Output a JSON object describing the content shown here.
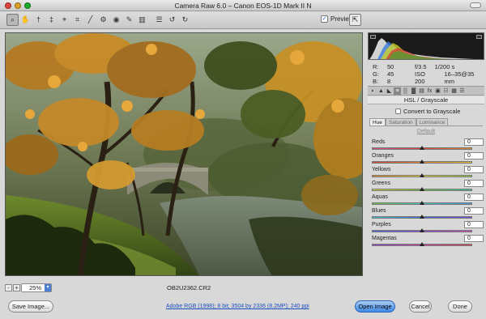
{
  "window": {
    "title": "Camera Raw 6.0  –  Canon EOS-1D Mark II N"
  },
  "toolbar": {
    "tools": [
      {
        "name": "zoom-tool-icon",
        "glyph": "⌕",
        "active": true
      },
      {
        "name": "hand-tool-icon",
        "glyph": "✋",
        "active": false
      },
      {
        "name": "white-balance-tool-icon",
        "glyph": "†",
        "active": false
      },
      {
        "name": "color-sampler-tool-icon",
        "glyph": "‡",
        "active": false
      },
      {
        "name": "targeted-adjustment-tool-icon",
        "glyph": "⌖",
        "active": false
      },
      {
        "name": "crop-tool-icon",
        "glyph": "⌗",
        "active": false
      },
      {
        "name": "straighten-tool-icon",
        "glyph": "╱",
        "active": false
      },
      {
        "name": "spot-removal-tool-icon",
        "glyph": "⚙",
        "active": false
      },
      {
        "name": "red-eye-tool-icon",
        "glyph": "◉",
        "active": false
      },
      {
        "name": "adjustment-brush-icon",
        "glyph": "✎",
        "active": false
      },
      {
        "name": "graduated-filter-icon",
        "glyph": "▥",
        "active": false
      },
      {
        "name": "preferences-icon",
        "glyph": "☰",
        "active": false
      },
      {
        "name": "rotate-left-icon",
        "glyph": "↺",
        "active": false
      },
      {
        "name": "rotate-right-icon",
        "glyph": "↻",
        "active": false
      }
    ],
    "preview_label": "Preview",
    "preview_checked": "✓",
    "fullscreen_glyph": "⇱"
  },
  "preview": {
    "zoom": "25%",
    "zoom_out": "-",
    "zoom_in": "+",
    "filename": "OB2U2362.CR2"
  },
  "readout": {
    "r_label": "R:",
    "r_value": "50",
    "g_label": "G:",
    "g_value": "45",
    "b_label": "B:",
    "b_value": "8",
    "aperture": "f/3.5",
    "shutter": "1/200 s",
    "iso": "ISO 200",
    "lens": "16–35@35 mm"
  },
  "panel_tabs": [
    "◐",
    "▲",
    "◣",
    "≡",
    "▒",
    "▓",
    "▤",
    "fx",
    "▣",
    "☷",
    "▦",
    "☰"
  ],
  "hsl": {
    "title": "HSL / Grayscale",
    "convert_label": "Convert to Grayscale",
    "tabs": [
      "Hue",
      "Saturation",
      "Luminance"
    ],
    "active_tab": 0,
    "default_label": "Default",
    "sliders": [
      {
        "label": "Reds",
        "value": "0",
        "gradient": [
          "#d14c8f",
          "#d9433a",
          "#e0892a"
        ]
      },
      {
        "label": "Oranges",
        "value": "0",
        "gradient": [
          "#d6443a",
          "#e2852c",
          "#e3c22c"
        ]
      },
      {
        "label": "Yellows",
        "value": "0",
        "gradient": [
          "#e2892c",
          "#e6d13a",
          "#8cc63c"
        ]
      },
      {
        "label": "Greens",
        "value": "0",
        "gradient": [
          "#d8cf3a",
          "#6fbf3c",
          "#3cbf9a"
        ]
      },
      {
        "label": "Aquas",
        "value": "0",
        "gradient": [
          "#6fbf3c",
          "#48c4c0",
          "#4a8fd4"
        ]
      },
      {
        "label": "Blues",
        "value": "0",
        "gradient": [
          "#45c1c6",
          "#3a6bd6",
          "#7a4ad6"
        ]
      },
      {
        "label": "Purples",
        "value": "0",
        "gradient": [
          "#4a6ad8",
          "#8a4ad0",
          "#cf48b8"
        ]
      },
      {
        "label": "Magentas",
        "value": "0",
        "gradient": [
          "#8a48d0",
          "#cf46a8",
          "#d8434d"
        ]
      }
    ]
  },
  "bottom": {
    "save_label": "Save Image...",
    "workflow_link": "Adobe RGB (1998); 8 bit; 3504 by 2336 (8.2MP); 240 ppi",
    "open_label": "Open Image",
    "cancel_label": "Cancel",
    "done_label": "Done"
  },
  "colors": {
    "accent": "#3d8ae6",
    "link": "#1a4fbf"
  }
}
